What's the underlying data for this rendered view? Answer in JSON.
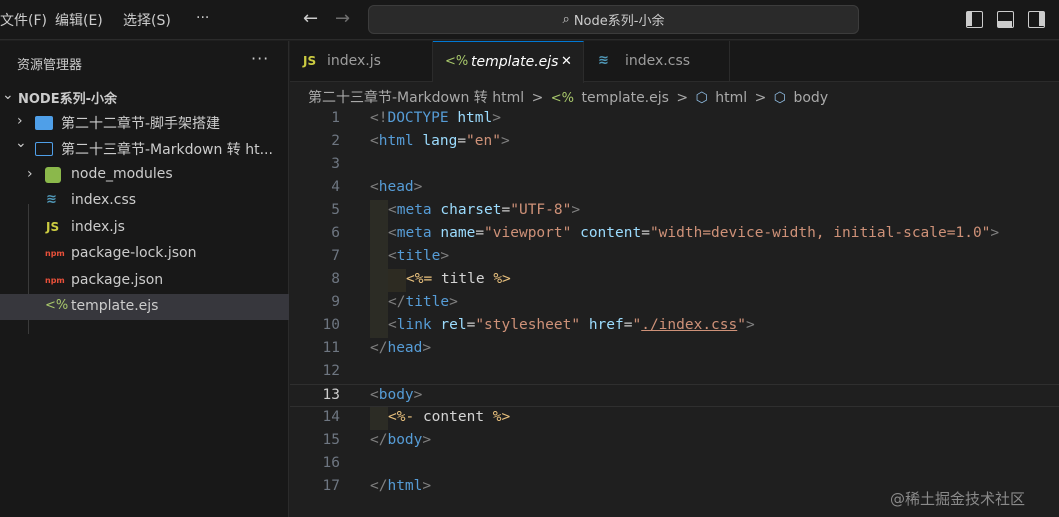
{
  "menu": {
    "file": "文件(F)",
    "edit": "编辑(E)",
    "select": "选择(S)",
    "more": "···"
  },
  "command_center": "Node系列-小余",
  "sidebar": {
    "header": "资源管理器",
    "more": "···",
    "root": "NODE系列-小余",
    "items": [
      {
        "label": "第二十二章节-脚手架搭建",
        "icon": "folder-closed-icon",
        "chevron": "›"
      },
      {
        "label": "第二十三章节-Markdown 转 ht...",
        "icon": "folder-open-icon",
        "chevron": "⌄"
      },
      {
        "label": "node_modules",
        "icon": "node-folder-icon",
        "chevron": "›"
      },
      {
        "label": "index.css",
        "icon": "css-file-icon",
        "glyph": "≋"
      },
      {
        "label": "index.js",
        "icon": "js-file-icon",
        "glyph": "JS"
      },
      {
        "label": "package-lock.json",
        "icon": "npm-file-icon",
        "glyph": "npm"
      },
      {
        "label": "package.json",
        "icon": "npm-file-icon",
        "glyph": "npm"
      },
      {
        "label": "template.ejs",
        "icon": "ejs-file-icon",
        "glyph": "<%"
      }
    ]
  },
  "tabs": [
    {
      "label": "index.js",
      "glyph": "JS"
    },
    {
      "label": "template.ejs",
      "glyph": "<%",
      "close": "✕"
    },
    {
      "label": "index.css",
      "glyph": "≋"
    }
  ],
  "breadcrumb": {
    "folder": "第二十三章节-Markdown 转 html",
    "file": "template.ejs",
    "node1": "html",
    "node2": "body",
    "sep": ">"
  },
  "editor": {
    "line_numbers": [
      "1",
      "2",
      "3",
      "4",
      "5",
      "6",
      "7",
      "8",
      "9",
      "10",
      "11",
      "12",
      "13",
      "14",
      "15",
      "16",
      "17"
    ],
    "current_line": 13
  },
  "watermark": "@稀土掘金技术社区",
  "colors": {
    "accent": "#0078d4",
    "tag": "#569cd6",
    "attr": "#9cdcfe",
    "string": "#ce9178"
  }
}
